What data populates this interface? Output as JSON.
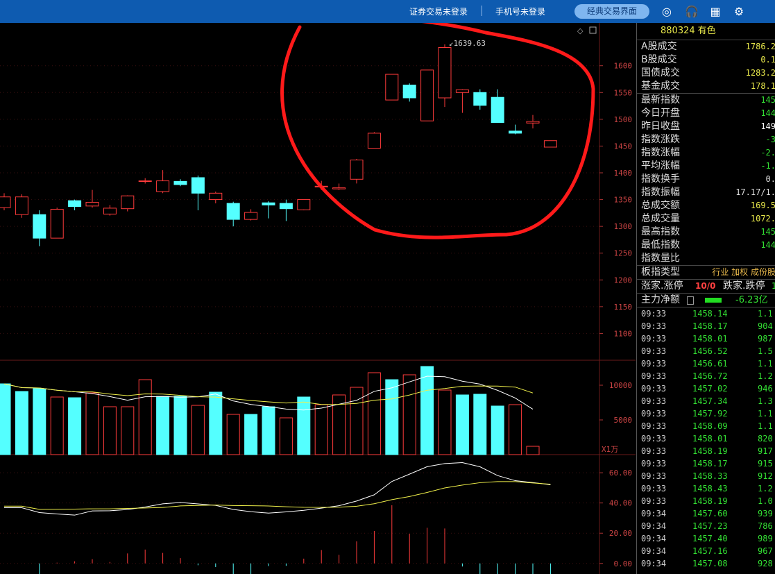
{
  "topbar": {
    "broker_login": "证券交易未登录",
    "phone_login": "手机号未登录",
    "classic_trade": "经典交易界面",
    "icons": [
      "spiral-logo-icon",
      "headset-icon",
      "grid-icon",
      "gear-icon"
    ]
  },
  "chart_data": [
    {
      "type": "candlestick",
      "title": "",
      "ylim": [
        1050,
        1680
      ],
      "y_ticks": [
        "1600",
        "1550",
        "1500",
        "1450",
        "1400",
        "1350",
        "1300",
        "1250",
        "1200",
        "1150",
        "1100"
      ],
      "annotation_max": "1639.63",
      "candles": [
        {
          "o": 1335,
          "c": 1355,
          "h": 1362,
          "l": 1330
        },
        {
          "o": 1322,
          "c": 1355,
          "h": 1360,
          "l": 1316
        },
        {
          "o": 1322,
          "c": 1278,
          "h": 1330,
          "l": 1263
        },
        {
          "o": 1278,
          "c": 1332,
          "h": 1335,
          "l": 1278
        },
        {
          "o": 1348,
          "c": 1337,
          "h": 1350,
          "l": 1330
        },
        {
          "o": 1338,
          "c": 1345,
          "h": 1368,
          "l": 1335
        },
        {
          "o": 1323,
          "c": 1334,
          "h": 1340,
          "l": 1320
        },
        {
          "o": 1333,
          "c": 1357,
          "h": 1358,
          "l": 1328
        },
        {
          "o": 1385,
          "c": 1385,
          "h": 1390,
          "l": 1380
        },
        {
          "o": 1365,
          "c": 1385,
          "h": 1405,
          "l": 1362
        },
        {
          "o": 1384,
          "c": 1378,
          "h": 1388,
          "l": 1375
        },
        {
          "o": 1391,
          "c": 1362,
          "h": 1395,
          "l": 1330
        },
        {
          "o": 1350,
          "c": 1362,
          "h": 1365,
          "l": 1343
        },
        {
          "o": 1343,
          "c": 1313,
          "h": 1346,
          "l": 1300
        },
        {
          "o": 1313,
          "c": 1326,
          "h": 1332,
          "l": 1311
        },
        {
          "o": 1344,
          "c": 1340,
          "h": 1347,
          "l": 1315
        },
        {
          "o": 1343,
          "c": 1333,
          "h": 1350,
          "l": 1310
        },
        {
          "o": 1331,
          "c": 1350,
          "h": 1350,
          "l": 1330
        },
        {
          "o": 1375,
          "c": 1375,
          "h": 1385,
          "l": 1368
        },
        {
          "o": 1370,
          "c": 1372,
          "h": 1380,
          "l": 1368
        },
        {
          "o": 1388,
          "c": 1424,
          "h": 1426,
          "l": 1380
        },
        {
          "o": 1446,
          "c": 1474,
          "h": 1476,
          "l": 1446
        },
        {
          "o": 1536,
          "c": 1584,
          "h": 1584,
          "l": 1536
        },
        {
          "o": 1564,
          "c": 1540,
          "h": 1567,
          "l": 1533
        },
        {
          "o": 1497,
          "c": 1592,
          "h": 1592,
          "l": 1497
        },
        {
          "o": 1540,
          "c": 1634,
          "h": 1640,
          "l": 1523
        },
        {
          "o": 1550,
          "c": 1555,
          "h": 1556,
          "l": 1512
        },
        {
          "o": 1550,
          "c": 1526,
          "h": 1556,
          "l": 1518
        },
        {
          "o": 1541,
          "c": 1494,
          "h": 1556,
          "l": 1494
        },
        {
          "o": 1478,
          "c": 1474,
          "h": 1490,
          "l": 1472
        },
        {
          "o": 1493,
          "c": 1496,
          "h": 1508,
          "l": 1483
        },
        {
          "o": 1448,
          "c": 1460,
          "h": 1460,
          "l": 1448
        }
      ]
    },
    {
      "type": "bar",
      "title": "",
      "unit_label": "X1万",
      "ylim": [
        0,
        13000
      ],
      "y_ticks": [
        "10000",
        "5000"
      ],
      "values": [
        10200,
        9100,
        9500,
        8300,
        8200,
        8900,
        6900,
        6900,
        10800,
        8400,
        8400,
        7100,
        9000,
        5800,
        5800,
        6900,
        5300,
        8300,
        7200,
        8600,
        9700,
        11800,
        10800,
        11500,
        12700,
        9300,
        8600,
        8700,
        7000,
        7200,
        1200
      ],
      "up": [
        0,
        0,
        0,
        1,
        0,
        1,
        1,
        1,
        1,
        0,
        0,
        1,
        0,
        1,
        0,
        0,
        1,
        0,
        1,
        1,
        1,
        1,
        0,
        1,
        0,
        1,
        0,
        0,
        0,
        1,
        1
      ]
    },
    {
      "type": "line",
      "title": "",
      "ylim": [
        -7,
        72
      ],
      "y_ticks": [
        "60.00",
        "40.00",
        "20.00",
        "0.00"
      ]
    }
  ],
  "panel": {
    "code": "880324",
    "name": "有色",
    "rows": [
      {
        "label": "A股成交",
        "value": "1786.2",
        "color": "#e8e84b"
      },
      {
        "label": "B股成交",
        "value": "0.1",
        "color": "#e8e84b"
      },
      {
        "label": "国债成交",
        "value": "1283.2",
        "color": "#e8e84b"
      },
      {
        "label": "基金成交",
        "value": "178.1",
        "color": "#e8e84b"
      }
    ],
    "rows2": [
      {
        "label": "最新指数",
        "value": "145",
        "color": "#33e033"
      },
      {
        "label": "今日开盘",
        "value": "144",
        "color": "#33e033"
      },
      {
        "label": "昨日收盘",
        "value": "149",
        "color": "#ffffff"
      },
      {
        "label": "指数涨跌",
        "value": "-3",
        "color": "#33e033"
      },
      {
        "label": "指数涨幅",
        "value": "-2.",
        "color": "#33e033"
      },
      {
        "label": "平均涨幅",
        "value": "-1.",
        "color": "#33e033"
      },
      {
        "label": "指数换手",
        "value": "0.",
        "color": "#dddddd"
      },
      {
        "label": "指数振幅",
        "value": "17.17/1.",
        "color": "#dddddd"
      },
      {
        "label": "总成交额",
        "value": "169.5",
        "color": "#e8e84b"
      },
      {
        "label": "总成交量",
        "value": "1072.",
        "color": "#e8e84b"
      },
      {
        "label": "最高指数",
        "value": "145",
        "color": "#33e033"
      },
      {
        "label": "最低指数",
        "value": "144",
        "color": "#33e033"
      },
      {
        "label": "指数量比",
        "value": "",
        "color": "#cc55cc"
      }
    ],
    "board_type_label": "板指类型",
    "board_type_value": "行业 加权 成份股",
    "limit_up_label": "涨家.涨停",
    "limit_up_value": "10/0",
    "limit_down_label": "跌家.跌停",
    "limit_down_value": "1",
    "main_net_label": "主力净额",
    "main_net_value": "-6.23亿",
    "ticks": [
      {
        "t": "09:33",
        "p": "1458.14",
        "v": "1.1"
      },
      {
        "t": "09:33",
        "p": "1458.17",
        "v": "904"
      },
      {
        "t": "09:33",
        "p": "1458.01",
        "v": "987"
      },
      {
        "t": "09:33",
        "p": "1456.52",
        "v": "1.5"
      },
      {
        "t": "09:33",
        "p": "1456.61",
        "v": "1.1"
      },
      {
        "t": "09:33",
        "p": "1456.72",
        "v": "1.2"
      },
      {
        "t": "09:33",
        "p": "1457.02",
        "v": "946"
      },
      {
        "t": "09:33",
        "p": "1457.34",
        "v": "1.3"
      },
      {
        "t": "09:33",
        "p": "1457.92",
        "v": "1.1"
      },
      {
        "t": "09:33",
        "p": "1458.09",
        "v": "1.1"
      },
      {
        "t": "09:33",
        "p": "1458.01",
        "v": "820"
      },
      {
        "t": "09:33",
        "p": "1458.19",
        "v": "917"
      },
      {
        "t": "09:33",
        "p": "1458.17",
        "v": "915"
      },
      {
        "t": "09:33",
        "p": "1458.33",
        "v": "912"
      },
      {
        "t": "09:33",
        "p": "1458.43",
        "v": "1.2"
      },
      {
        "t": "09:33",
        "p": "1458.19",
        "v": "1.0"
      },
      {
        "t": "09:34",
        "p": "1457.60",
        "v": "939"
      },
      {
        "t": "09:34",
        "p": "1457.23",
        "v": "786"
      },
      {
        "t": "09:34",
        "p": "1457.40",
        "v": "989"
      },
      {
        "t": "09:34",
        "p": "1457.16",
        "v": "967"
      },
      {
        "t": "09:34",
        "p": "1457.08",
        "v": "928"
      }
    ]
  },
  "colors": {
    "up": "#ff3b3b",
    "down": "#54ffff",
    "bg": "#000000",
    "topbar": "#0e5bb0",
    "ma_white": "#ffffff",
    "ma_yellow": "#f0f04a"
  }
}
